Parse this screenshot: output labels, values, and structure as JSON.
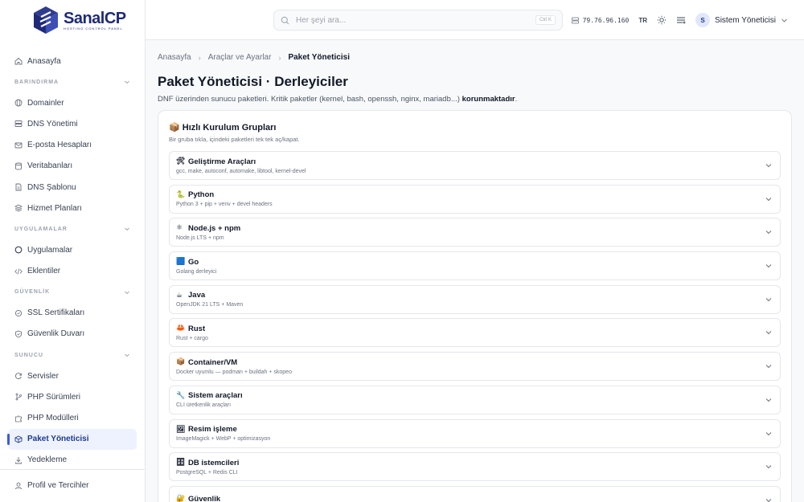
{
  "brand": {
    "name": "SanalCP",
    "sub": "HOSTING CONTROL PANEL"
  },
  "search": {
    "placeholder": "Her şeyi ara...",
    "shortcut": "Ctrl K"
  },
  "header": {
    "ip": "79.76.96.160",
    "lang": "TR",
    "user_initial": "S",
    "user_name": "Sistem Yöneticisi"
  },
  "sidebar": {
    "home": "Anasayfa",
    "sections": [
      {
        "title": "BARINDIRMA",
        "items": [
          "Domainler",
          "DNS Yönetimi",
          "E-posta Hesapları",
          "Veritabanları",
          "DNS Şablonu",
          "Hizmet Planları"
        ]
      },
      {
        "title": "UYGULAMALAR",
        "items": [
          "Uygulamalar",
          "Eklentiler"
        ]
      },
      {
        "title": "GÜVENLİK",
        "items": [
          "SSL Sertifikaları",
          "Güvenlik Duvarı"
        ]
      },
      {
        "title": "SUNUCU",
        "items": [
          "Servisler",
          "PHP Sürümleri",
          "PHP Modülleri",
          "Paket Yöneticisi",
          "Yedekleme"
        ]
      }
    ],
    "profile": "Profil ve Tercihler"
  },
  "breadcrumb": [
    "Anasayfa",
    "Araçlar ve Ayarlar",
    "Paket Yöneticisi"
  ],
  "page": {
    "title": "Paket Yöneticisi · Derleyiciler",
    "desc_prefix": "DNF üzerinden sunucu paketleri. Kritik paketler (kernel, bash, openssh, nginx, mariadb...) ",
    "desc_bold": "korunmaktadır",
    "desc_suffix": "."
  },
  "card": {
    "title": "📦 Hızlı Kurulum Grupları",
    "subtitle": "Bir gruba tıkla, içindeki paketleri tek tek aç/kapat.",
    "groups": [
      {
        "emoji": "🛠",
        "name": "Geliştirme Araçları",
        "desc": "gcc, make, autoconf, automake, libtool, kernel-devel"
      },
      {
        "emoji": "🐍",
        "name": "Python",
        "desc": "Python 3 + pip + venv + devel headers"
      },
      {
        "emoji": "⚛",
        "name": "Node.js + npm",
        "desc": "Node.js LTS + npm"
      },
      {
        "emoji": "🟦",
        "name": "Go",
        "desc": "Golang derleyici"
      },
      {
        "emoji": "☕",
        "name": "Java",
        "desc": "OpenJDK 21 LTS + Maven"
      },
      {
        "emoji": "🦀",
        "name": "Rust",
        "desc": "Rust + cargo"
      },
      {
        "emoji": "📦",
        "name": "Container/VM",
        "desc": "Docker uyumlu — podman + buildah + skopeo"
      },
      {
        "emoji": "🔧",
        "name": "Sistem araçları",
        "desc": "CLI üretkenlik araçları"
      },
      {
        "emoji": "🖼",
        "name": "Resim işleme",
        "desc": "ImageMagick + WebP + optimizasyon"
      },
      {
        "emoji": "🗄",
        "name": "DB istemcileri",
        "desc": "PostgreSQL + Redis CLI"
      },
      {
        "emoji": "🔐",
        "name": "Güvenlik",
        "desc": ""
      }
    ]
  },
  "colors": {
    "accent": "#3b5bdb",
    "brand": "#1e2a78",
    "active_bg": "#eef2ff"
  }
}
